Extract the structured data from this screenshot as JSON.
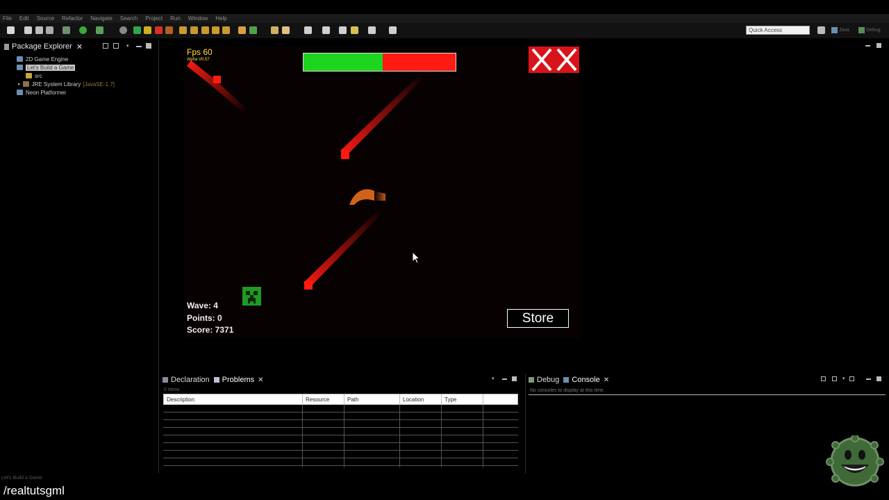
{
  "menubar": {
    "items": [
      "File",
      "Edit",
      "Source",
      "Refactor",
      "Navigate",
      "Search",
      "Project",
      "Run",
      "Window",
      "Help"
    ]
  },
  "toolbar": {
    "quick_access_placeholder": "Quick Access",
    "perspective_java": "Java",
    "perspective_debug": "Debug"
  },
  "package_explorer": {
    "title": "Package Explorer",
    "close_glyph": "✕",
    "items": [
      {
        "label": "2D Game Engine",
        "tag": ""
      },
      {
        "label": "Let's Build a Game",
        "tag": ""
      },
      {
        "label": "src",
        "tag": ""
      },
      {
        "label": "JRE System Library",
        "tag": "[JavaSE-1.7]"
      },
      {
        "label": "Neon Platformer",
        "tag": ""
      }
    ]
  },
  "game": {
    "fps": "Fps 60",
    "version": "Alpha V0.57",
    "health": 0.52,
    "wave": "Wave: 4",
    "points": "Points: 0",
    "score": "Score: 7371",
    "store_label": "Store",
    "colors": {
      "health_green": "#1dd41e",
      "health_red": "#ff1a12",
      "enemy_red": "#ff1a12",
      "player_orange": "#d2621a",
      "text_yellow": "#ffe23a"
    }
  },
  "problems_panel": {
    "tabs": [
      {
        "label": "Declaration",
        "active": false
      },
      {
        "label": "Problems",
        "active": true
      }
    ],
    "close_glyph": "✕",
    "item_count": "0 items",
    "columns": [
      "Description",
      "Resource",
      "Path",
      "Location",
      "Type"
    ]
  },
  "console_panel": {
    "tabs": [
      {
        "label": "Debug",
        "active": false
      },
      {
        "label": "Console",
        "active": true
      }
    ],
    "close_glyph": "✕",
    "empty_message": "No consoles to display at this time."
  },
  "status": {
    "selected": "Let's Build a Game"
  },
  "watermark": "/realtutsgml"
}
